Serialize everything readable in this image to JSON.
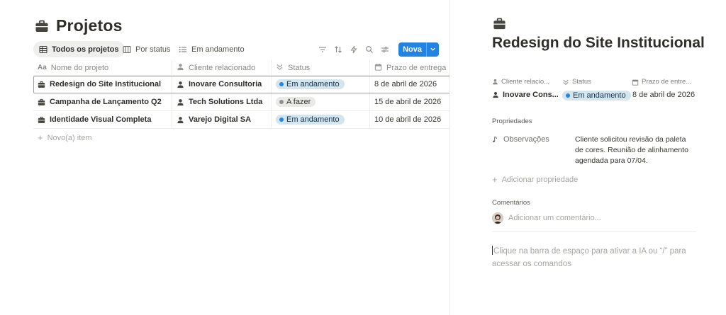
{
  "page": {
    "title": "Projetos",
    "icon": "briefcase-icon"
  },
  "views": [
    {
      "label": "Todos os projetos",
      "icon": "table-icon",
      "active": true
    },
    {
      "label": "Por status",
      "icon": "board-icon",
      "active": false
    },
    {
      "label": "Em andamento",
      "icon": "list-icon",
      "active": false
    }
  ],
  "toolbar": {
    "tools": [
      "filter-icon",
      "sort-icon",
      "automation-icon",
      "search-icon",
      "settings-icon"
    ],
    "new_label": "Nova"
  },
  "table": {
    "columns": [
      {
        "label": "Nome do projeto",
        "icon": "title-icon"
      },
      {
        "label": "Cliente relacionado",
        "icon": "person-icon"
      },
      {
        "label": "Status",
        "icon": "status-icon"
      },
      {
        "label": "Prazo de entrega",
        "icon": "calendar-icon"
      }
    ],
    "rows": [
      {
        "name": "Redesign do Site Institucional",
        "client": "Inovare Consultoria",
        "status": "Em andamento",
        "status_color": "#2383e2",
        "due": "8 de abril de 2026",
        "selected": true
      },
      {
        "name": "Campanha de Lançamento Q2",
        "client": "Tech Solutions Ltda",
        "status": "A fazer",
        "status_color": "#91918e",
        "due": "15 de abril de 2026",
        "selected": false
      },
      {
        "name": "Identidade Visual Completa",
        "client": "Varejo Digital SA",
        "status": "Em andamento",
        "status_color": "#2383e2",
        "due": "10 de abril de 2026",
        "selected": false
      }
    ],
    "new_item_label": "Novo(a) item"
  },
  "detail": {
    "title": "Redesign do Site Institucional",
    "prop_headers": [
      "Cliente relacio...",
      "Status",
      "Prazo de entre..."
    ],
    "client_value": "Inovare Cons...",
    "status_value": "Em andamento",
    "due_value": "8 de abril de 2026",
    "properties_label": "Propriedades",
    "obs_label": "Observações",
    "obs_text": "Cliente solicitou revisão da paleta de cores. Reunião de alinhamento agendada para 07/04.",
    "add_property_label": "Adicionar propriedade",
    "comments_label": "Comentários",
    "comment_placeholder": "Adicionar um comentário...",
    "ai_hint": "Clique na barra de espaço para ativar a IA ou “/” para acessar os comandos"
  },
  "colors": {
    "accent": "#2383e2",
    "status_blue_bg": "#d3e5ef",
    "status_gray_bg": "#e9e9e7"
  }
}
